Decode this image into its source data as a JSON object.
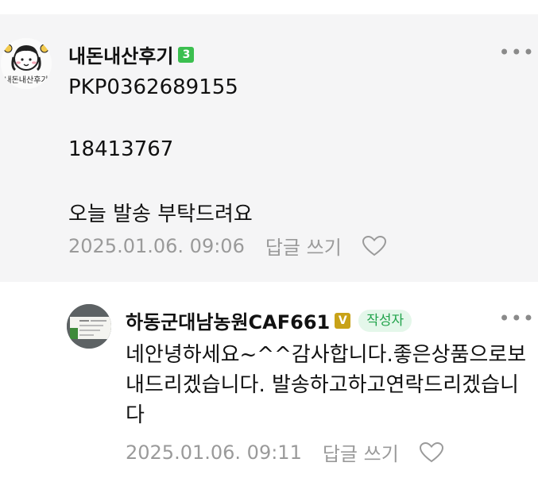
{
  "comment": {
    "nickname": "내돈내산후기",
    "level": "3",
    "lines": [
      "PKP0362689155",
      "18413767",
      "오늘 발송 부탁드려요"
    ],
    "timestamp": "2025.01.06. 09:06",
    "reply_label": "답글 쓰기",
    "avatar_icon": "avatar-icon",
    "avatar_text": "내돈내산후기"
  },
  "reply": {
    "nickname": "하동군대남농원CAF661",
    "level": "V",
    "author_badge": "작성자",
    "text": "네안녕하세요~^^감사합니다.좋은상품으로보내드리겠습니다. 발송하고하고연락드리겠습니다",
    "timestamp": "2025.01.06. 09:11",
    "reply_label": "답글 쓰기"
  },
  "more_label": "•••",
  "colors": {
    "comment_bg": "#f5f5f6",
    "author_badge_bg": "#e4f7ea",
    "author_badge_text": "#21a34b",
    "level_green": "#3bbf4f",
    "level_gold": "#c8a218",
    "meta_gray": "#9a9a9a"
  }
}
